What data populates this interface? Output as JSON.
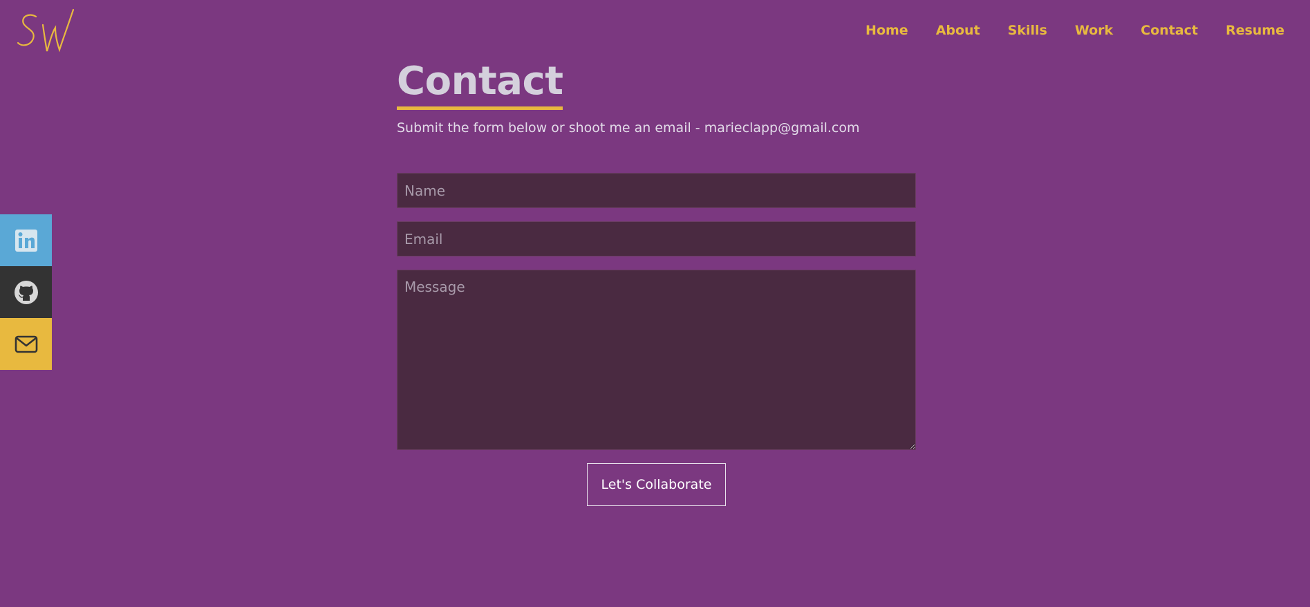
{
  "brand": {
    "logo_text": "SW",
    "accent_color": "#e8b93f",
    "background_color": "#7b3880"
  },
  "nav": {
    "items": [
      {
        "label": "Home"
      },
      {
        "label": "About"
      },
      {
        "label": "Skills"
      },
      {
        "label": "Work"
      },
      {
        "label": "Contact"
      },
      {
        "label": "Resume"
      }
    ]
  },
  "social": {
    "linkedin": {
      "icon": "linkedin-icon",
      "color": "#5aa8d6"
    },
    "github": {
      "icon": "github-icon",
      "color": "#333333"
    },
    "email": {
      "icon": "mail-icon",
      "color": "#e8b93f"
    }
  },
  "contact": {
    "title": "Contact",
    "subtitle_text": "Submit the form below or shoot me an email - ",
    "email": "marieclapp@gmail.com",
    "form": {
      "name_placeholder": "Name",
      "email_placeholder": "Email",
      "message_placeholder": "Message",
      "submit_label": "Let's Collaborate"
    }
  }
}
